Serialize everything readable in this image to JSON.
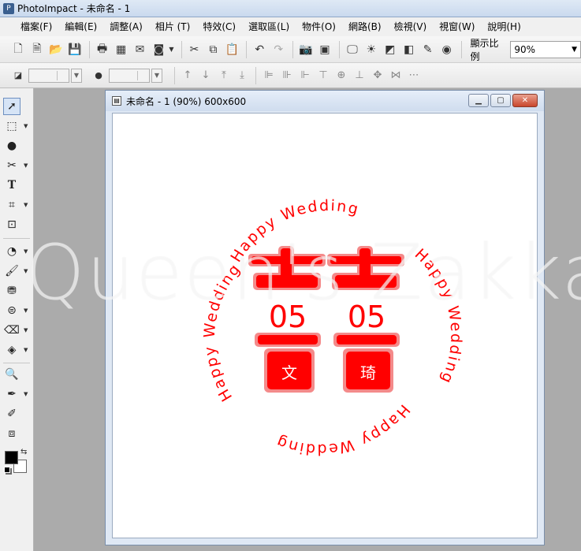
{
  "window": {
    "title": "PhotoImpact - 未命名 - 1",
    "app_icon": "app-icon"
  },
  "menu": [
    "檔案(F)",
    "編輯(E)",
    "調整(A)",
    "相片 (T)",
    "特效(C)",
    "選取區(L)",
    "物件(O)",
    "網路(B)",
    "檢視(V)",
    "視窗(W)",
    "說明(H)"
  ],
  "toolbar": {
    "zoom_label": "顯示比例",
    "zoom_value": "90%"
  },
  "document": {
    "title": "未命名 - 1 (90%) 600x600"
  },
  "artwork": {
    "ring_text": "Happy Wedding",
    "date_left": "05",
    "date_right": "05",
    "name_left": "文",
    "name_right": "琦",
    "color": "#ff0000"
  },
  "watermark": "Queen's Zakka"
}
